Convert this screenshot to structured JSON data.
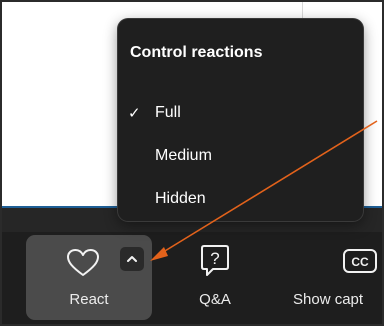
{
  "menu": {
    "title": "Control reactions",
    "items": [
      {
        "label": "Full",
        "checked": true,
        "check_glyph": "✓"
      },
      {
        "label": "Medium",
        "checked": false
      },
      {
        "label": "Hidden",
        "checked": false
      }
    ]
  },
  "toolbar": {
    "react_label": "React",
    "qa_label": "Q&A",
    "captions_label": "Show capt"
  },
  "icons": {
    "heart": "heart-icon",
    "chevron": "chevron-up-icon",
    "qa": "question-bubble-icon",
    "cc": "closed-captions-icon"
  },
  "colors": {
    "annotation_arrow": "#e2621b",
    "menu_bg": "#1f1f1f",
    "toolbar_bg": "#1e1e1e",
    "react_button_bg": "#4b4b4b"
  }
}
